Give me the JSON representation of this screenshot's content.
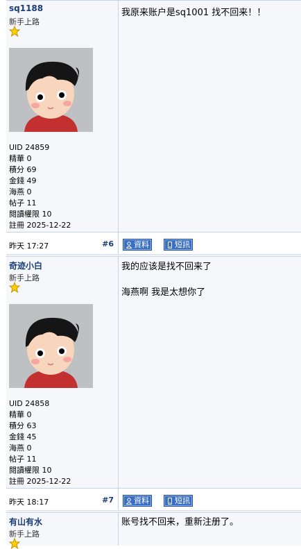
{
  "posts": [
    {
      "username": "sq1188",
      "rank": "新手上路",
      "stats": {
        "uid": "UID 24859",
        "jinghua": "精華 0",
        "jifen": "積分 69",
        "jinqian": "金錢 49",
        "haiyan": "海燕 0",
        "tiezi": "帖子 11",
        "yuedu": "閱讀權限 10",
        "zhuce": "註冊 2025-12-22"
      },
      "time": "昨天 17:27",
      "number": "#6",
      "content": [
        "我原来账户是sq1001  找不回来！！"
      ],
      "profile_btn": "資料",
      "pm_btn": "短訊"
    },
    {
      "username": "奇迹小白",
      "rank": "新手上路",
      "stats": {
        "uid": "UID 24858",
        "jinghua": "精華 0",
        "jifen": "積分 63",
        "jinqian": "金錢 45",
        "haiyan": "海燕 0",
        "tiezi": "帖子 11",
        "yuedu": "閱讀權限 10",
        "zhuce": "註冊 2025-12-22"
      },
      "time": "昨天 18:17",
      "number": "#7",
      "content": [
        "我的应该是找不回来了",
        "海燕啊 我是太想你了"
      ],
      "profile_btn": "資料",
      "pm_btn": "短訊"
    },
    {
      "username": "有山有水",
      "rank": "新手上路",
      "content": [
        "账号找不回来，重新注册了。"
      ]
    }
  ]
}
